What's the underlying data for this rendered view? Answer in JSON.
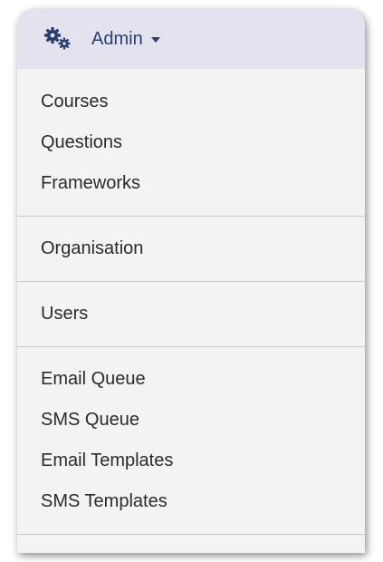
{
  "menu": {
    "header": {
      "icon": "gears-icon",
      "label": "Admin",
      "caret_icon": "caret-down-icon"
    },
    "groups": [
      [
        "Courses",
        "Questions",
        "Frameworks"
      ],
      [
        "Organisation"
      ],
      [
        "Users"
      ],
      [
        "Email Queue",
        "SMS Queue",
        "Email Templates",
        "SMS Templates"
      ]
    ]
  },
  "colors": {
    "header_bg": "#e3e2ee",
    "menu_bg": "#f3f3f4",
    "header_text": "#2a3f6e",
    "item_text": "#2b2b2b",
    "divider": "#c9c9cd"
  }
}
